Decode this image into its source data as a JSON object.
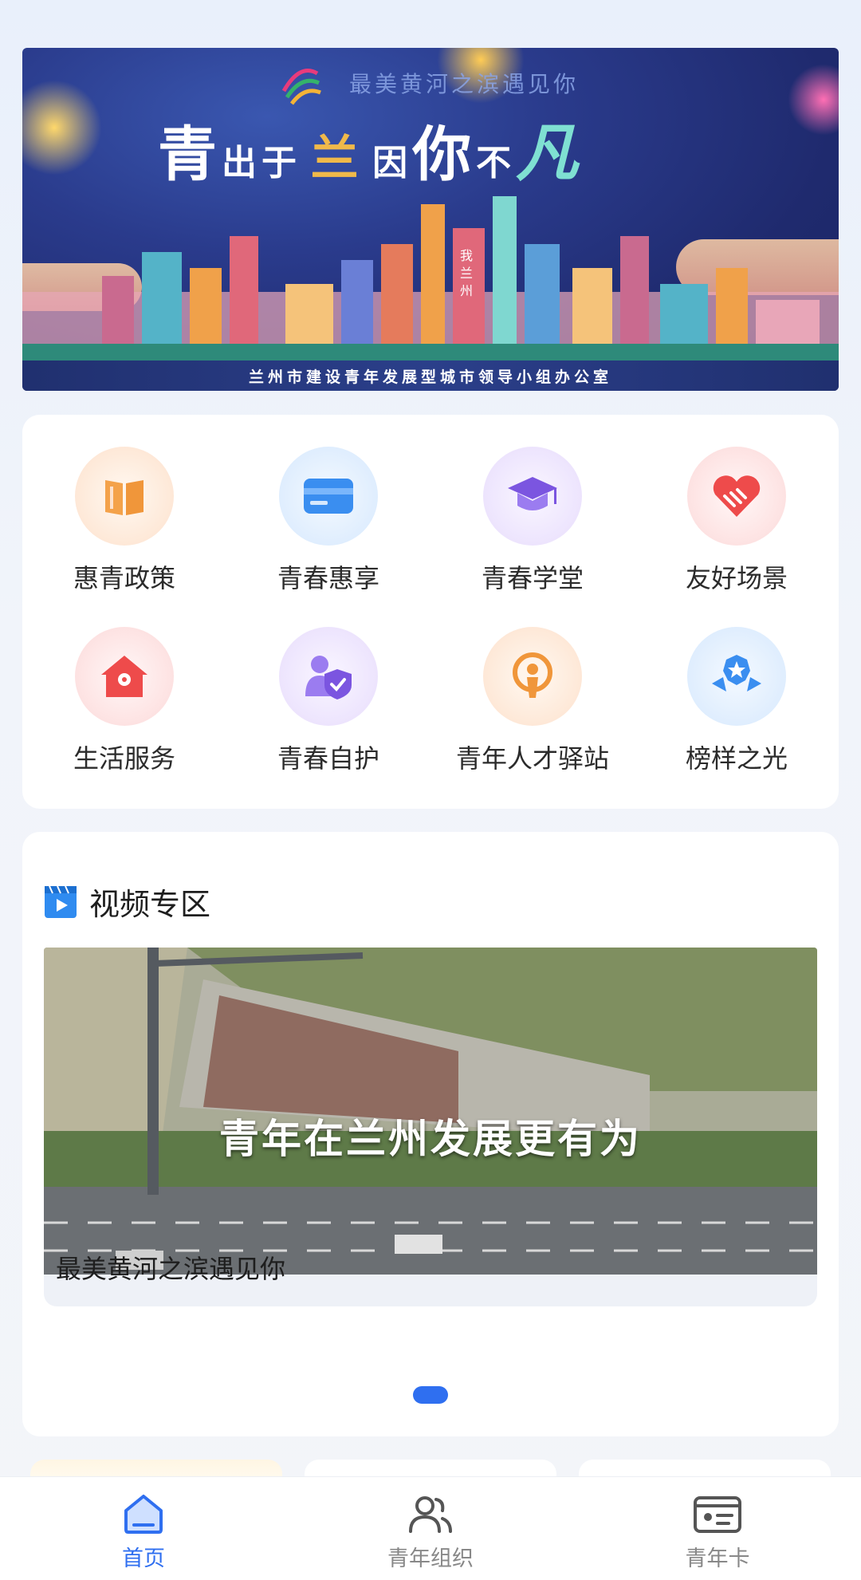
{
  "banner": {
    "tagline": "最美黄河之滨遇见你",
    "headline": [
      "青",
      "出",
      "于",
      "兰",
      "因",
      "你",
      "不",
      "凡"
    ],
    "building_text": "我 兰 州",
    "footer": "兰州市建设青年发展型城市领导小组办公室"
  },
  "services": {
    "items": [
      {
        "label": "惠青政策",
        "icon": "book-icon",
        "bg": "#fde7d6",
        "color": "#f0963a"
      },
      {
        "label": "青春惠享",
        "icon": "card-icon",
        "bg": "#dcecfd",
        "color": "#3a8ef0"
      },
      {
        "label": "青春学堂",
        "icon": "graduation-cap-icon",
        "bg": "#ece4fc",
        "color": "#7b55e0"
      },
      {
        "label": "友好场景",
        "icon": "heart-handshake-icon",
        "bg": "#fde1e1",
        "color": "#ee4b4b"
      },
      {
        "label": "生活服务",
        "icon": "home-location-icon",
        "bg": "#fde1e1",
        "color": "#ee4b4b"
      },
      {
        "label": "青春自护",
        "icon": "user-shield-icon",
        "bg": "#ece4fc",
        "color": "#7b55e0"
      },
      {
        "label": "青年人才驿站",
        "icon": "talent-badge-icon",
        "bg": "#fde7d6",
        "color": "#f0963a"
      },
      {
        "label": "榜样之光",
        "icon": "star-ribbon-icon",
        "bg": "#dcecfd",
        "color": "#3a8ef0"
      }
    ]
  },
  "video": {
    "section_title": "视频专区",
    "overlay_text": "青年在兰州发展更有为",
    "caption": "最美黄河之滨遇见你"
  },
  "tabbar": {
    "tabs": [
      {
        "label": "首页",
        "icon": "home-icon",
        "active": true
      },
      {
        "label": "青年组织",
        "icon": "people-icon",
        "active": false
      },
      {
        "label": "青年卡",
        "icon": "id-card-icon",
        "active": false
      }
    ]
  },
  "colors": {
    "accent": "#2f6ff0",
    "inactive": "#888888"
  }
}
